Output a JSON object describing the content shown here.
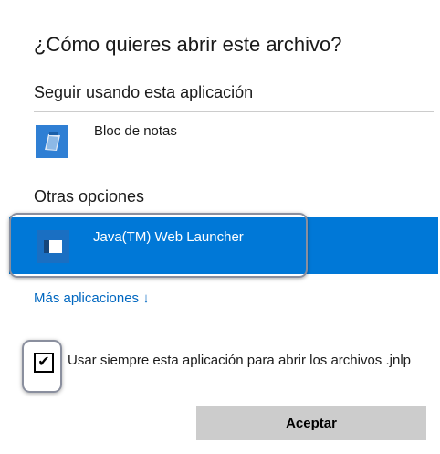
{
  "dialog": {
    "title": "¿Cómo quieres abrir este archivo?",
    "keep_using_heading": "Seguir usando esta aplicación",
    "other_options_heading": "Otras opciones",
    "more_apps_link": "Más aplicaciones ↓",
    "always_use_checkbox": {
      "checked": true,
      "label": "Usar siempre esta aplicación para abrir los archivos .jnlp"
    },
    "accept_button": "Aceptar"
  },
  "apps": {
    "current": {
      "name": "Bloc de notas",
      "icon": "notepad-icon"
    },
    "options": [
      {
        "name": "Java(TM) Web Launcher",
        "icon": "java-launcher-icon",
        "selected": true
      }
    ]
  },
  "colors": {
    "selection": "#0078d7",
    "link": "#0067c0",
    "button": "#cccccc",
    "callout_border": "#8a8f9e"
  }
}
